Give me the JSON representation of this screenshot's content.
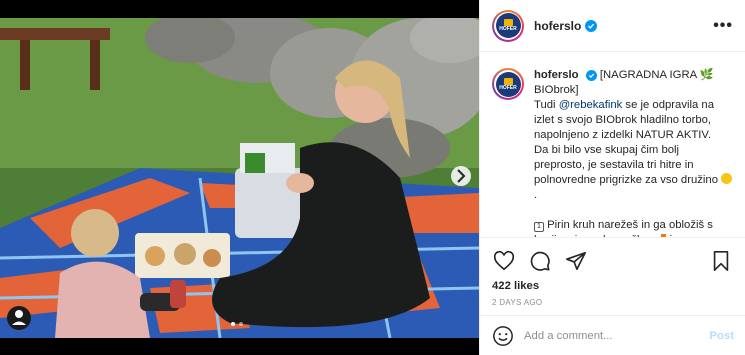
{
  "post": {
    "username": "hoferslo",
    "avatar_text": "HOFER",
    "more_icon": "more-horizontal-icon",
    "caption": {
      "username": "hoferslo",
      "line1": "[NAGRADNA IGRA ",
      "line1b": "BIObrok]",
      "line2a": "Tudi ",
      "mention": "@rebekafink",
      "line2b": " se je odpravila na izlet s svojo BIObrok hladilno torbo, napolnjeno z izdelki NATUR AKTIV.",
      "line3": "Da bi bilo vse skupaj čim bolj preprosto, je sestavila tri hitre in polnovredne prigrizke za vso družino",
      "line4": "Pirin kruh narežeš in ga obložiš s kozjim sirom, korenčkom ",
      "line4b": " in"
    },
    "likes": "422 likes",
    "timestamp": "2 DAYS AGO",
    "comment_placeholder": "Add a comment...",
    "post_button": "Post",
    "colors": {
      "verified": "#0095f6",
      "link": "#00376b",
      "post_disabled": "#b2dffc"
    }
  }
}
